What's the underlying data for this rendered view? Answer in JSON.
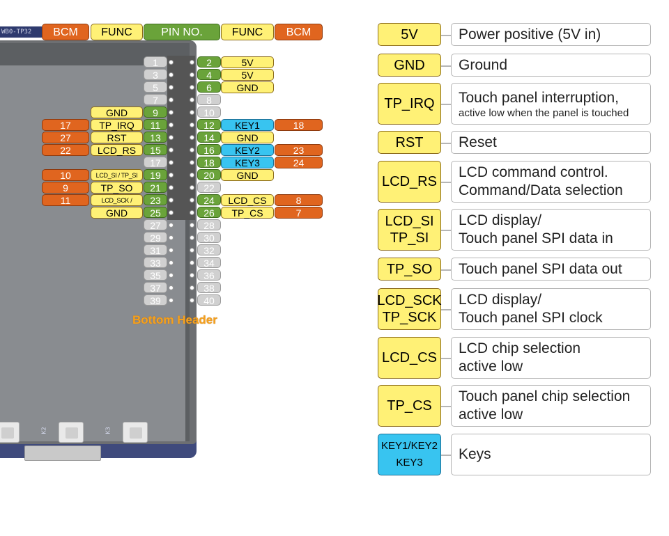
{
  "board": {
    "title_strip": "WB0-TP32",
    "keys": [
      "K2",
      "K3"
    ]
  },
  "header_row": {
    "bcm_left": "BCM",
    "func_left": "FUNC",
    "pin_no": "PIN NO.",
    "func_right": "FUNC",
    "bcm_right": "BCM"
  },
  "pins": [
    {
      "num": "1",
      "g": false
    },
    {
      "num": "2",
      "g": true
    },
    {
      "num": "3",
      "g": false
    },
    {
      "num": "4",
      "g": true
    },
    {
      "num": "5",
      "g": false
    },
    {
      "num": "6",
      "g": true
    },
    {
      "num": "7",
      "g": false
    },
    {
      "num": "8",
      "g": false
    },
    {
      "num": "9",
      "g": true
    },
    {
      "num": "10",
      "g": false
    },
    {
      "num": "11",
      "g": true
    },
    {
      "num": "12",
      "g": true
    },
    {
      "num": "13",
      "g": true
    },
    {
      "num": "14",
      "g": true
    },
    {
      "num": "15",
      "g": true
    },
    {
      "num": "16",
      "g": true
    },
    {
      "num": "17",
      "g": false
    },
    {
      "num": "18",
      "g": true
    },
    {
      "num": "19",
      "g": true
    },
    {
      "num": "20",
      "g": true
    },
    {
      "num": "21",
      "g": true
    },
    {
      "num": "22",
      "g": false
    },
    {
      "num": "23",
      "g": true
    },
    {
      "num": "24",
      "g": true
    },
    {
      "num": "25",
      "g": true
    },
    {
      "num": "26",
      "g": true
    },
    {
      "num": "27",
      "g": false
    },
    {
      "num": "28",
      "g": false
    },
    {
      "num": "29",
      "g": false
    },
    {
      "num": "30",
      "g": false
    },
    {
      "num": "31",
      "g": false
    },
    {
      "num": "32",
      "g": false
    },
    {
      "num": "33",
      "g": false
    },
    {
      "num": "34",
      "g": false
    },
    {
      "num": "35",
      "g": false
    },
    {
      "num": "36",
      "g": false
    },
    {
      "num": "37",
      "g": false
    },
    {
      "num": "38",
      "g": false
    },
    {
      "num": "39",
      "g": false
    },
    {
      "num": "40",
      "g": false
    }
  ],
  "left_funcs": [
    {
      "row": 4,
      "func": "GND"
    },
    {
      "row": 5,
      "func": "TP_IRQ",
      "bcm": "17"
    },
    {
      "row": 6,
      "func": "RST",
      "bcm": "27"
    },
    {
      "row": 7,
      "func": "LCD_RS",
      "bcm": "22"
    },
    {
      "row": 9,
      "func": "LCD_SI / TP_SI",
      "bcm": "10",
      "small": true
    },
    {
      "row": 10,
      "func": "TP_SO",
      "bcm": "9"
    },
    {
      "row": 11,
      "func": "LCD_SCK / TP_SCK",
      "bcm": "11",
      "small": true
    },
    {
      "row": 12,
      "func": "GND"
    }
  ],
  "right_funcs": [
    {
      "row": 0,
      "func": "5V"
    },
    {
      "row": 1,
      "func": "5V"
    },
    {
      "row": 2,
      "func": "GND"
    },
    {
      "row": 5,
      "func": "KEY1",
      "bcm": "18",
      "blue": true
    },
    {
      "row": 6,
      "func": "GND"
    },
    {
      "row": 7,
      "func": "KEY2",
      "bcm": "23",
      "blue": true
    },
    {
      "row": 8,
      "func": "KEY3",
      "bcm": "24",
      "blue": true
    },
    {
      "row": 9,
      "func": "GND"
    },
    {
      "row": 11,
      "func": "LCD_CS",
      "bcm": "8"
    },
    {
      "row": 12,
      "func": "TP_CS",
      "bcm": "7"
    }
  ],
  "bottom_header": "Bottom Header",
  "legend": [
    {
      "key": "5V",
      "desc": [
        "Power positive (5V in)"
      ]
    },
    {
      "key": "GND",
      "desc": [
        "Ground"
      ]
    },
    {
      "key": "TP_IRQ",
      "desc": [
        "Touch panel interruption,"
      ],
      "sub": "active low when the panel is touched"
    },
    {
      "key": "RST",
      "desc": [
        "Reset"
      ]
    },
    {
      "key": "LCD_RS",
      "desc": [
        "LCD command control.",
        "Command/Data selection"
      ]
    },
    {
      "key": "LCD_SI\nTP_SI",
      "desc": [
        "LCD display/",
        "Touch panel SPI data in"
      ]
    },
    {
      "key": "TP_SO",
      "desc": [
        "Touch panel SPI data out"
      ]
    },
    {
      "key": "LCD_SCK\nTP_SCK",
      "desc": [
        "LCD display/",
        "Touch panel SPI clock"
      ]
    },
    {
      "key": "LCD_CS",
      "desc": [
        "LCD chip selection",
        "active low"
      ]
    },
    {
      "key": "TP_CS",
      "desc": [
        "Touch panel chip selection",
        "active low"
      ]
    },
    {
      "key": "KEY1/KEY2\nKEY3",
      "desc": [
        "Keys"
      ],
      "blue": true
    }
  ],
  "colors": {
    "bcm": "#e0651f",
    "func": "#fff176",
    "pin": "#6aa33a",
    "key": "#38c4f0",
    "board": "#3f4a7c"
  }
}
